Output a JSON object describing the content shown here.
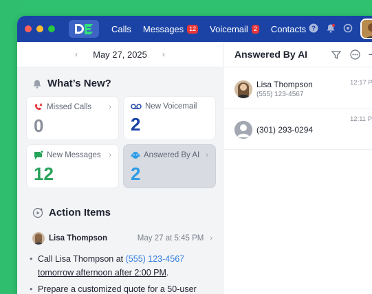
{
  "titlebar": {
    "logo_text": "DE",
    "nav": [
      {
        "label": "Calls",
        "badge": ""
      },
      {
        "label": "Messages",
        "badge": "12"
      },
      {
        "label": "Voicemail",
        "badge": "2"
      },
      {
        "label": "Contacts",
        "badge": ""
      }
    ],
    "icons": [
      "help-icon",
      "bell-icon",
      "settings-icon"
    ]
  },
  "datebar": {
    "date": "May 27, 2025"
  },
  "whats_new": {
    "title": "What’s New?",
    "cards": [
      {
        "label": "Missed Calls",
        "value": "0",
        "color": "#8a909c",
        "icon": "missed-call-icon"
      },
      {
        "label": "New Voicemail",
        "value": "2",
        "color": "#1b43a6",
        "icon": "voicemail-icon"
      },
      {
        "label": "New Messages",
        "value": "12",
        "color": "#27a35a",
        "icon": "message-icon"
      },
      {
        "label": "Answered By AI",
        "value": "2",
        "color": "#2d9be6",
        "icon": "ai-icon"
      }
    ]
  },
  "action_items": {
    "title": "Action Items",
    "contact": "Lisa Thompson",
    "time": "May 27 at 5:45 PM",
    "bullet1_pre": "Call Lisa Thompson at ",
    "bullet1_link": "(555) 123-4567",
    "bullet1_under": "tomorrow afternoon after 2:00 PM",
    "bullet1_post": ".",
    "bullet2": "Prepare a customized quote for a 50-user"
  },
  "ai_panel": {
    "title": "Answered By AI",
    "rows": [
      {
        "name": "Lisa Thompson",
        "phone": "(555) 123-4567",
        "time": "12:17 P"
      },
      {
        "name": "(301) 293-0294",
        "phone": "",
        "time": "12:11 P"
      }
    ]
  },
  "colors": {
    "accent_blue": "#1b43a6",
    "badge_red": "#e5373b",
    "green": "#27a35a",
    "ai_blue": "#2d9be6"
  }
}
